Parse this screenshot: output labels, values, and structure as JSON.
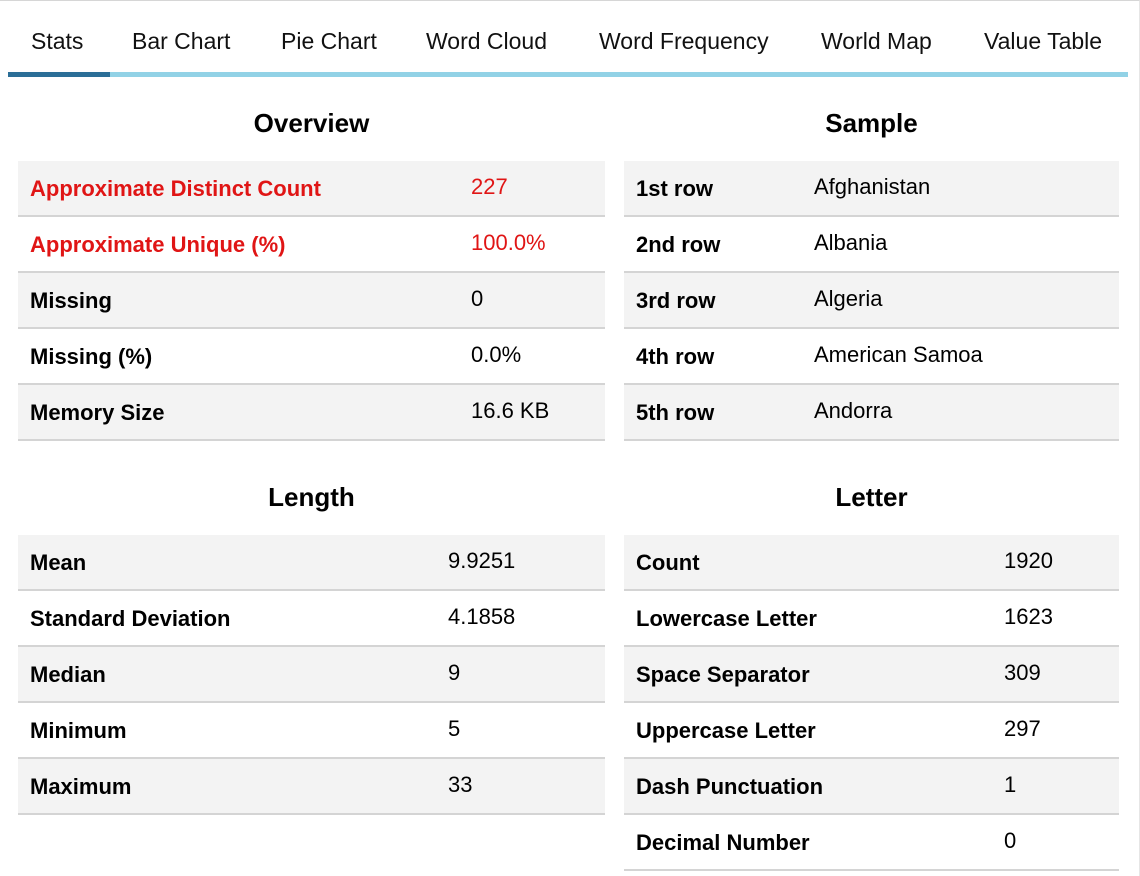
{
  "tabs": [
    "Stats",
    "Bar Chart",
    "Pie Chart",
    "Word Cloud",
    "Word Frequency",
    "World Map",
    "Value Table"
  ],
  "active_tab": "Stats",
  "overview": {
    "title": "Overview",
    "rows": [
      {
        "label": "Approximate Distinct Count",
        "value": "227"
      },
      {
        "label": "Approximate Unique (%)",
        "value": "100.0%"
      },
      {
        "label": "Missing",
        "value": "0"
      },
      {
        "label": "Missing (%)",
        "value": "0.0%"
      },
      {
        "label": "Memory Size",
        "value": "16.6 KB"
      }
    ]
  },
  "sample": {
    "title": "Sample",
    "rows": [
      {
        "label": "1st row",
        "value": "Afghanistan"
      },
      {
        "label": "2nd row",
        "value": "Albania"
      },
      {
        "label": "3rd row",
        "value": "Algeria"
      },
      {
        "label": "4th row",
        "value": "American Samoa"
      },
      {
        "label": "5th row",
        "value": "Andorra"
      }
    ]
  },
  "length": {
    "title": "Length",
    "rows": [
      {
        "label": "Mean",
        "value": "9.9251"
      },
      {
        "label": "Standard Deviation",
        "value": "4.1858"
      },
      {
        "label": "Median",
        "value": "9"
      },
      {
        "label": "Minimum",
        "value": "5"
      },
      {
        "label": "Maximum",
        "value": "33"
      }
    ]
  },
  "letter": {
    "title": "Letter",
    "rows": [
      {
        "label": "Count",
        "value": "1920"
      },
      {
        "label": "Lowercase Letter",
        "value": "1623"
      },
      {
        "label": "Space Separator",
        "value": "309"
      },
      {
        "label": "Uppercase Letter",
        "value": "297"
      },
      {
        "label": "Dash Punctuation",
        "value": "1"
      },
      {
        "label": "Decimal Number",
        "value": "0"
      }
    ]
  },
  "colors": {
    "warning_text": "#e01515",
    "tab_underline": "#92d2e6",
    "tab_active_underline": "#2b6e97",
    "row_stripe": "#f3f3f3"
  }
}
